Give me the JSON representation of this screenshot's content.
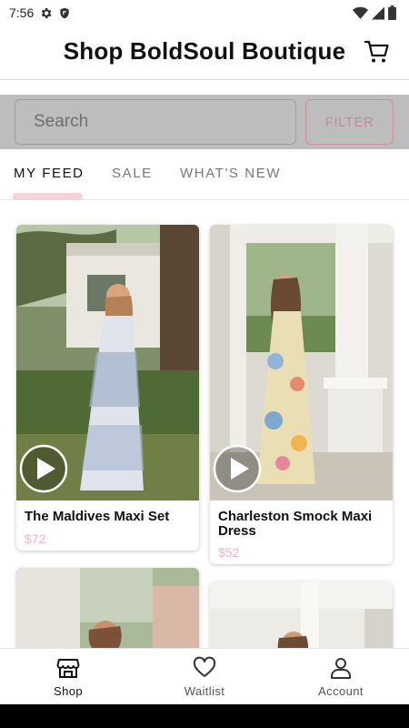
{
  "status_bar": {
    "time": "7:56"
  },
  "header": {
    "title": "Shop BoldSoul Boutique"
  },
  "search": {
    "placeholder": "Search",
    "filter_label": "FILTER"
  },
  "tabs": [
    {
      "label": "MY FEED",
      "active": true
    },
    {
      "label": "SALE",
      "active": false
    },
    {
      "label": "WHAT'S NEW",
      "active": false
    }
  ],
  "products": [
    {
      "name": "The Maldives Maxi Set",
      "price": "$72",
      "has_video": true
    },
    {
      "name": "Charleston Smock Maxi Dress",
      "price": "$52",
      "has_video": true
    },
    {
      "name": "",
      "price": ""
    },
    {
      "name": "",
      "price": ""
    }
  ],
  "bottom_nav": [
    {
      "label": "Shop",
      "icon": "storefront-icon",
      "active": true
    },
    {
      "label": "Waitlist",
      "icon": "heart-icon",
      "active": false
    },
    {
      "label": "Account",
      "icon": "person-icon",
      "active": false
    }
  ],
  "colors": {
    "accent_pink": "#f5d3db",
    "price_pink": "#f1b4c3",
    "search_band": "#bdbdbd"
  }
}
